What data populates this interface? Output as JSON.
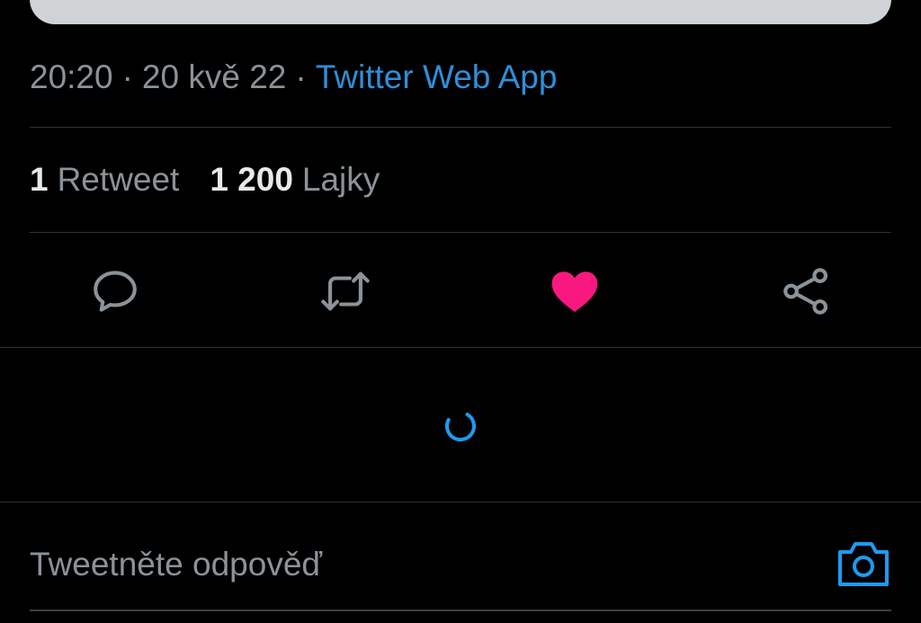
{
  "tweet": {
    "time": "20:20",
    "date": "20 kvě 22",
    "separator": "·",
    "source": "Twitter Web App"
  },
  "stats": {
    "retweets_count": "1",
    "retweets_label": "Retweet",
    "likes_count": "1 200",
    "likes_label": "Lajky"
  },
  "actions": [
    {
      "icon": "reply-icon",
      "color": "#8b9298"
    },
    {
      "icon": "retweet-icon",
      "color": "#8b9298"
    },
    {
      "icon": "heart-filled-icon",
      "color": "#f91880"
    },
    {
      "icon": "share-icon",
      "color": "#8b9298"
    }
  ],
  "reply": {
    "placeholder": "Tweetněte odpověď"
  },
  "colors": {
    "background": "#000000",
    "accent": "#1d9bf0",
    "like": "#f91880",
    "muted": "#8b9298",
    "divider": "#2f3336"
  }
}
